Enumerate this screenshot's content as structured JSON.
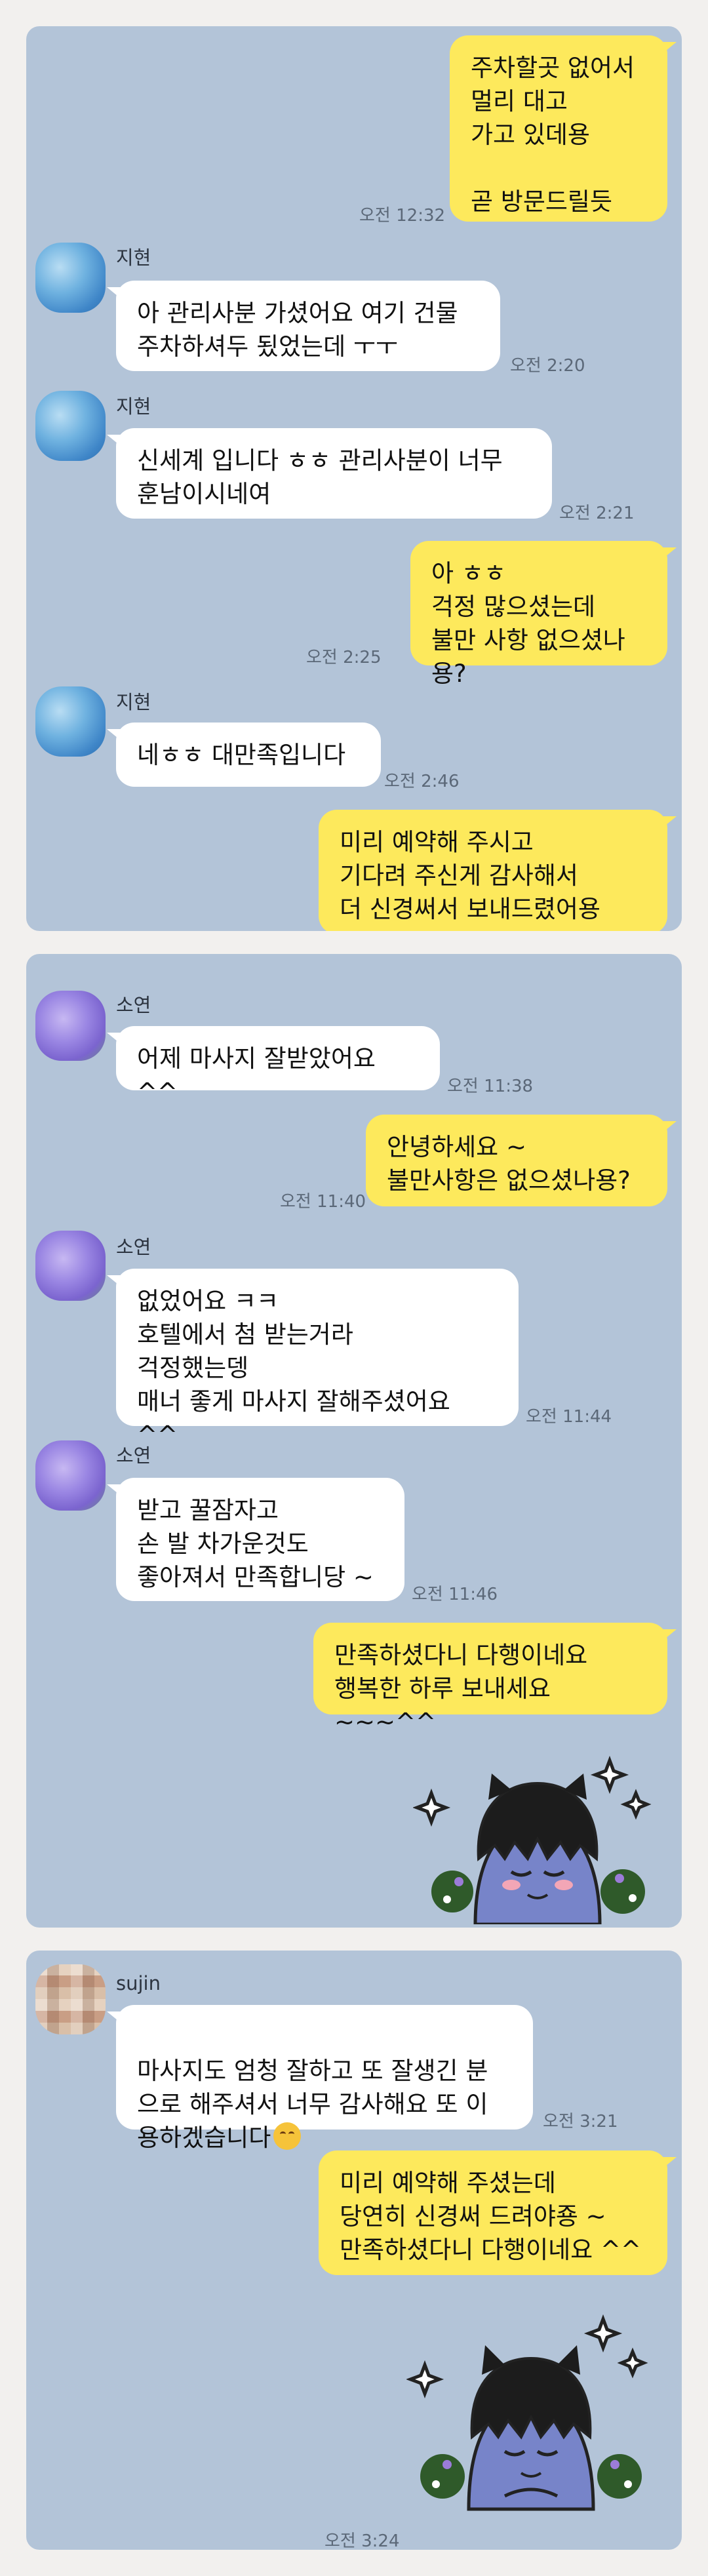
{
  "panel1": {
    "m1": {
      "text": "주차할곳 없어서\n멀리 대고\n가고 있데용\n\n곧 방문드릴듯",
      "time": "오전 12:32"
    },
    "m2": {
      "sender": "지현",
      "text": "아 관리사분 가셨어요 여기 건물\n주차하셔두 됬었는데 ㅜㅜ",
      "time": "오전 2:20"
    },
    "m3": {
      "sender": "지현",
      "text": "신세계 입니다 ㅎㅎ 관리사분이 너무\n훈남이시네여",
      "time": "오전 2:21"
    },
    "m4": {
      "text": "아 ㅎㅎ\n걱정 많으셨는데\n불만 사항 없으셨나용?",
      "time": "오전 2:25"
    },
    "m5": {
      "sender": "지현",
      "text": "네ㅎㅎ 대만족입니다",
      "time": "오전 2:46"
    },
    "m6": {
      "text": "미리 예약해 주시고\n기다려 주신게 감사해서\n더 신경써서 보내드렸어용 ^^"
    }
  },
  "panel2": {
    "m1": {
      "sender": "소연",
      "text": "어제 마사지 잘받았어요 ^^",
      "time": "오전 11:38"
    },
    "m2": {
      "text": "안녕하세요 ~\n불만사항은 없으셨나용?",
      "time": "오전 11:40"
    },
    "m3": {
      "sender": "소연",
      "text": "없었어요 ㅋㅋ\n호텔에서 첨 받는거라\n걱정했는뎅\n매너 좋게 마사지 잘해주셨어요 ^^",
      "time": "오전 11:44"
    },
    "m4": {
      "sender": "소연",
      "text": "받고 꿀잠자고\n손 발 차가운것도\n좋아져서 만족합니당 ~",
      "time": "오전 11:46"
    },
    "m5": {
      "text": "만족하셨다니 다행이네요\n행복한 하루 보내세요 ~~~^^"
    }
  },
  "panel3": {
    "m1": {
      "sender": "sujin",
      "text": "마사지도 엄청 잘하고 또 잘생긴 분\n으로 해주셔서 너무 감사해요 또 이\n용하겠습니다",
      "time": "오전 3:21"
    },
    "m2": {
      "text": "미리 예약해 주셨는데\n당연히 신경써 드려야죵 ~\n만족하셨다니 다행이네요 ^^"
    },
    "sticker_time": "오전 3:24"
  },
  "colors": {
    "chat_background": "#b3c4d8",
    "my_bubble": "#fde95c",
    "their_bubble": "#ffffff"
  },
  "icons": {
    "smile_emoji": "smiling-face-emoji",
    "sticker": "kakao-character-sticker"
  }
}
